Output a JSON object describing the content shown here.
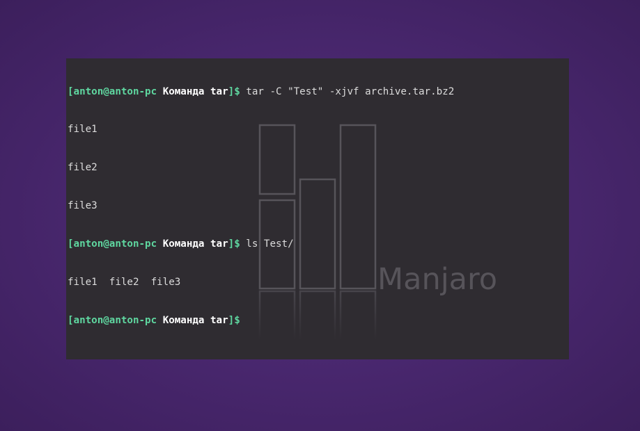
{
  "wallpaper": {
    "logo_text": "Manjaro"
  },
  "colors": {
    "prompt_user": "#5fd7a0",
    "prompt_dir": "#ffffff",
    "text": "#dcdcdc",
    "terminal_bg": "#2f2c31",
    "desktop_bg": "#4a2870"
  },
  "terminal": {
    "lines": [
      {
        "type": "prompt",
        "open": "[",
        "user": "anton@anton-pc",
        "dir": "Команда tar",
        "close": "]$",
        "command": " tar -C \"Test\" -xjvf archive.tar.bz2"
      },
      {
        "type": "output",
        "text": "file1"
      },
      {
        "type": "output",
        "text": "file2"
      },
      {
        "type": "output",
        "text": "file3"
      },
      {
        "type": "prompt",
        "open": "[",
        "user": "anton@anton-pc",
        "dir": "Команда tar",
        "close": "]$",
        "command": " ls Test/"
      },
      {
        "type": "output",
        "text": "file1  file2  file3"
      },
      {
        "type": "prompt",
        "open": "[",
        "user": "anton@anton-pc",
        "dir": "Команда tar",
        "close": "]$",
        "command": ""
      }
    ]
  }
}
